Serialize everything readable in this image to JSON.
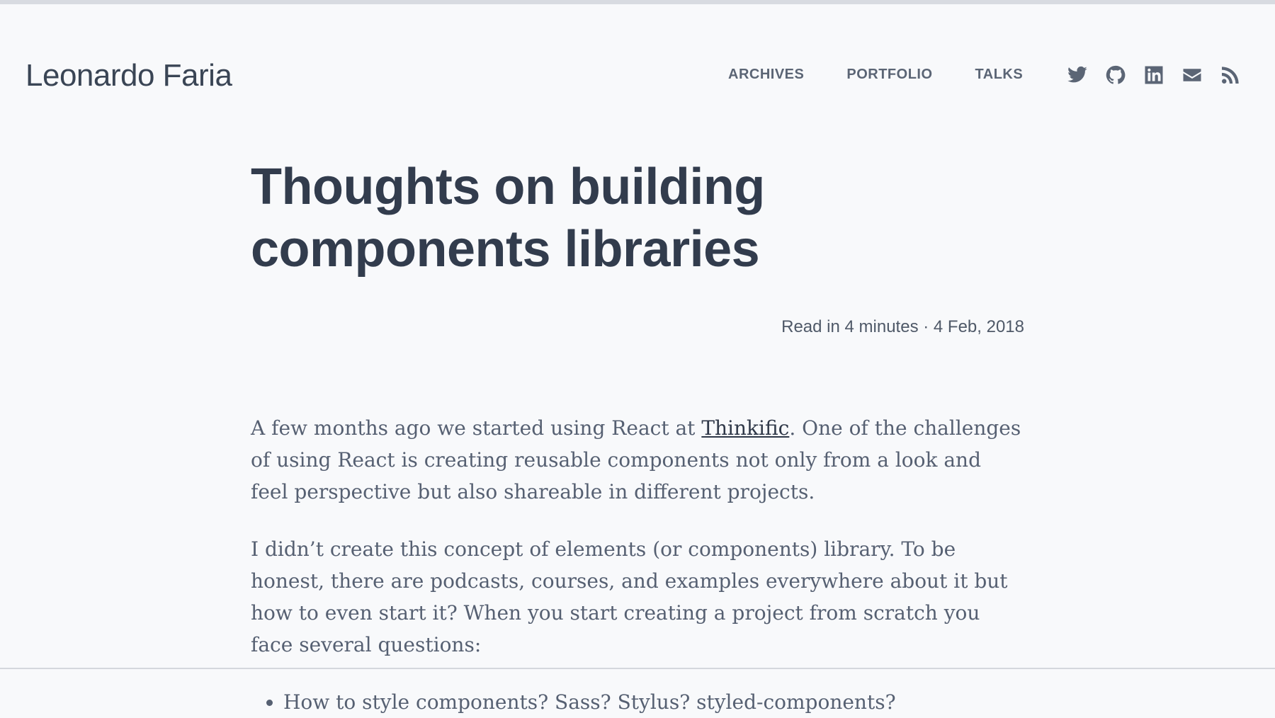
{
  "site": {
    "title": "Leonardo Faria"
  },
  "nav": {
    "items": [
      {
        "label": "ARCHIVES"
      },
      {
        "label": "PORTFOLIO"
      },
      {
        "label": "TALKS"
      }
    ]
  },
  "social": [
    {
      "icon": "twitter-icon"
    },
    {
      "icon": "github-icon"
    },
    {
      "icon": "linkedin-icon"
    },
    {
      "icon": "email-icon"
    },
    {
      "icon": "rss-icon"
    }
  ],
  "post": {
    "title": "Thoughts on building components libraries",
    "meta": "Read in 4 minutes · 4 Feb, 2018",
    "p1_before": "A few months ago we started using React at ",
    "p1_link": "Thinkific",
    "p1_after": ". One of the challenges of using React is creating reusable components not only from a look and feel perspective but also shareable in different projects.",
    "p2": "I didn’t create this concept of elements (or components) library. To be honest, there are podcasts, courses, and examples everywhere about it but how to even start it? When you start creating a project from scratch you face several questions:",
    "list": [
      "How to style components? Sass? Stylus? styled-components?"
    ]
  },
  "colors": {
    "background": "#f8f9fb",
    "text": "#364152",
    "body": "#566072"
  }
}
